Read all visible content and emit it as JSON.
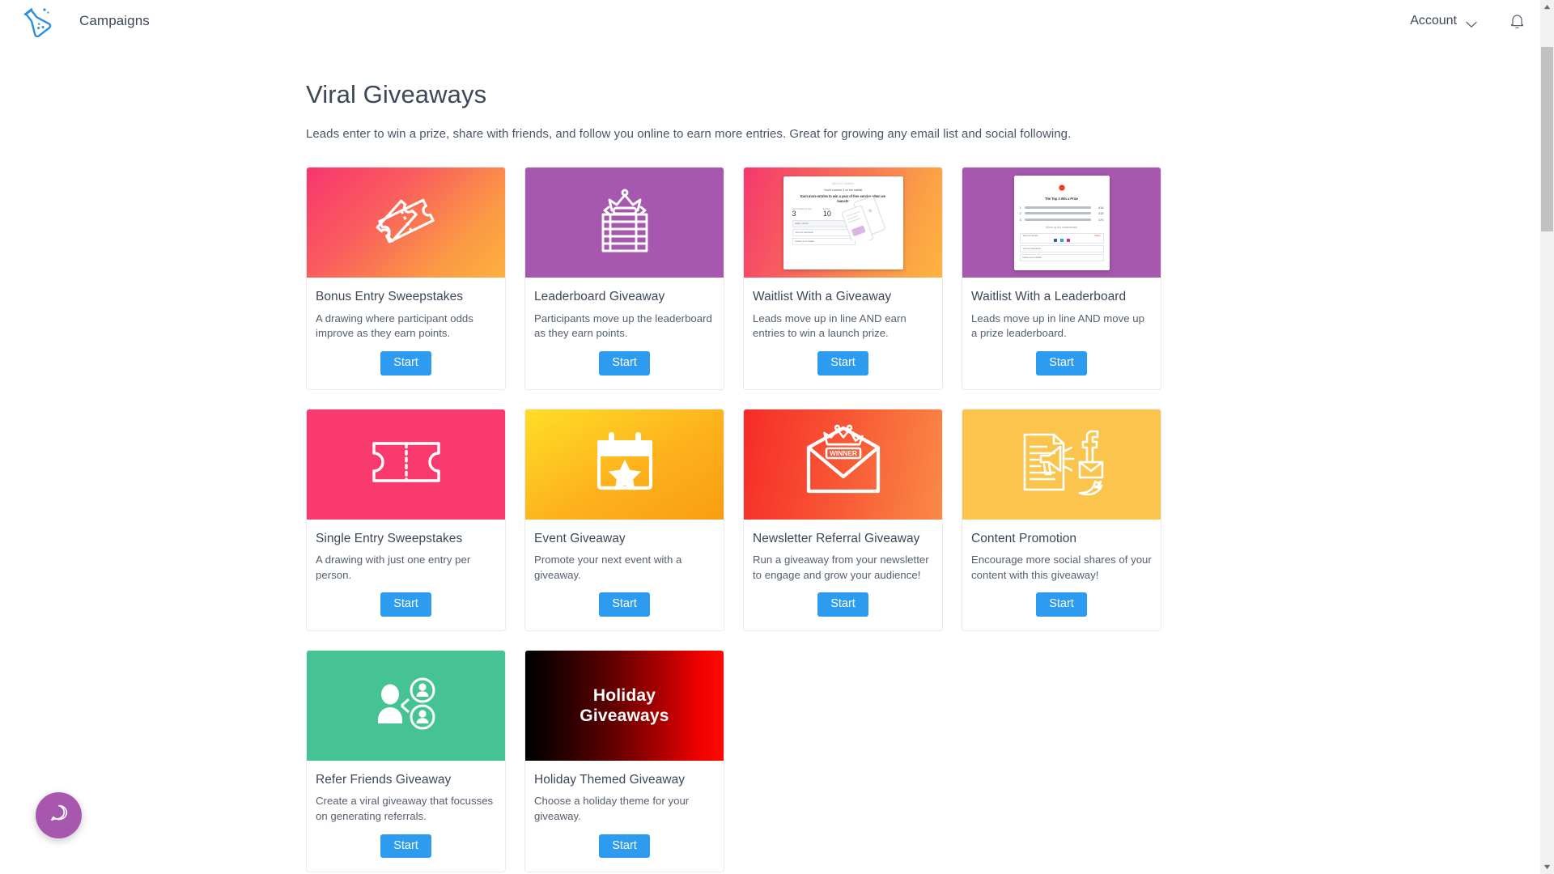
{
  "topbar": {
    "logo_icon": "beaker-flask-icon",
    "brand": "Campaigns",
    "account_label": "Account",
    "chevron_icon": "chevron-down-icon",
    "bell_icon": "notification-bell-icon"
  },
  "page": {
    "title": "Viral Giveaways",
    "subtitle": "Leads enter to win a prize, share with friends, and follow you online to earn more entries. Great for growing any email list and social following."
  },
  "cards": [
    {
      "name": "Bonus Entry Sweepstakes",
      "description": "A drawing where participant odds improve as they earn points.",
      "button": "Start",
      "icon": "two-tickets-icon",
      "media_style": "bg-grad-pinkorange",
      "colors": {
        "from": "#f8356e",
        "to": "#fcb040"
      }
    },
    {
      "name": "Leaderboard Giveaway",
      "description": "Participants move up the leaderboard as they earn points.",
      "button": "Start",
      "icon": "crown-leaderboard-icon",
      "media_style": "bg-purple",
      "colors": {
        "from": "#a558ae",
        "to": "#a558ae"
      }
    },
    {
      "name": "Waitlist With a Giveaway",
      "description": "Leads move up in line AND earn entries to win a launch prize.",
      "button": "Start",
      "icon": "waitlist-screenshot-preview",
      "media_style": "bg-grad-pinkorange2",
      "colors": {
        "from": "#f5376d",
        "to": "#fcb53f"
      },
      "preview": {
        "brand_line": "WAITLIST LANDING",
        "subhead": "You're number 3 on the waitlist",
        "headline": "Earn more entries to win a year of free service when we launch!",
        "stat1_label": "Your Position in Line",
        "stat1_value": "3",
        "stat2_label": "Entries",
        "stat2_value": "10",
        "rows": [
          "Refer a friend",
          "Visit our Facebook",
          "Follow us on Twitter"
        ]
      }
    },
    {
      "name": "Waitlist With a Leaderboard",
      "description": "Leads move up in line AND move up a prize leaderboard.",
      "button": "Start",
      "icon": "leaderboard-screenshot-preview",
      "media_style": "bg-purple",
      "colors": {
        "from": "#a558ae",
        "to": "#a558ae"
      },
      "preview": {
        "headline": "The Top 3 Win a Prize",
        "ranks": [
          {
            "place": "1",
            "value": "418"
          },
          {
            "place": "2",
            "value": "418"
          },
          {
            "place": "3",
            "value": "170"
          }
        ],
        "subhead": "Move up the leaderboard",
        "rows": [
          "Tell your friends",
          "Visit our Facebook",
          "Follow us on Twitter"
        ],
        "share_label": "Share"
      }
    },
    {
      "name": "Single Entry Sweepstakes",
      "description": "A drawing with just one entry per person.",
      "button": "Start",
      "icon": "single-ticket-icon",
      "media_style": "bg-pink",
      "colors": {
        "from": "#f93a6f",
        "to": "#f93a6f"
      }
    },
    {
      "name": "Event Giveaway",
      "description": "Promote your next event with a giveaway.",
      "button": "Start",
      "icon": "calendar-star-icon",
      "media_style": "bg-grad-yellow",
      "colors": {
        "from": "#ffde28",
        "to": "#f99d12"
      }
    },
    {
      "name": "Newsletter Referral Giveaway",
      "description": "Run a giveaway from your newsletter to engage and grow your audience!",
      "button": "Start",
      "icon": "envelope-winner-crown-icon",
      "media_style": "bg-grad-red",
      "colors": {
        "from": "#f52c26",
        "to": "#fa8a46"
      },
      "badge_text": "WINNER"
    },
    {
      "name": "Content Promotion",
      "description": "Encourage more social shares of your content with this giveaway!",
      "button": "Start",
      "icon": "document-megaphone-social-icon",
      "media_style": "bg-amber",
      "colors": {
        "from": "#fbc44c",
        "to": "#fbc44c"
      }
    },
    {
      "name": "Refer Friends Giveaway",
      "description": "Create a viral giveaway that focusses on generating referrals.",
      "button": "Start",
      "icon": "referral-people-icon",
      "media_style": "bg-green",
      "colors": {
        "from": "#45c395",
        "to": "#45c395"
      }
    },
    {
      "name": "Holiday Themed Giveaway",
      "description": "Choose a holiday theme for your giveaway.",
      "button": "Start",
      "icon": "holiday-text-banner",
      "media_style": "bg-holiday",
      "colors": {
        "from": "#000000",
        "to": "#ff0a00"
      },
      "media_text": "Holiday\nGiveaways"
    }
  ],
  "help_widget": {
    "icon": "chat-bubble-icon"
  },
  "scrollbar": {
    "up_arrow": "scroll-up-arrow-icon",
    "down_arrow": "scroll-down-arrow-icon"
  },
  "theme": {
    "accent": "#2d9cf0",
    "text": "#3c4858",
    "logo_blue": "#2a8fe0",
    "help_purple": "#a857ae"
  }
}
